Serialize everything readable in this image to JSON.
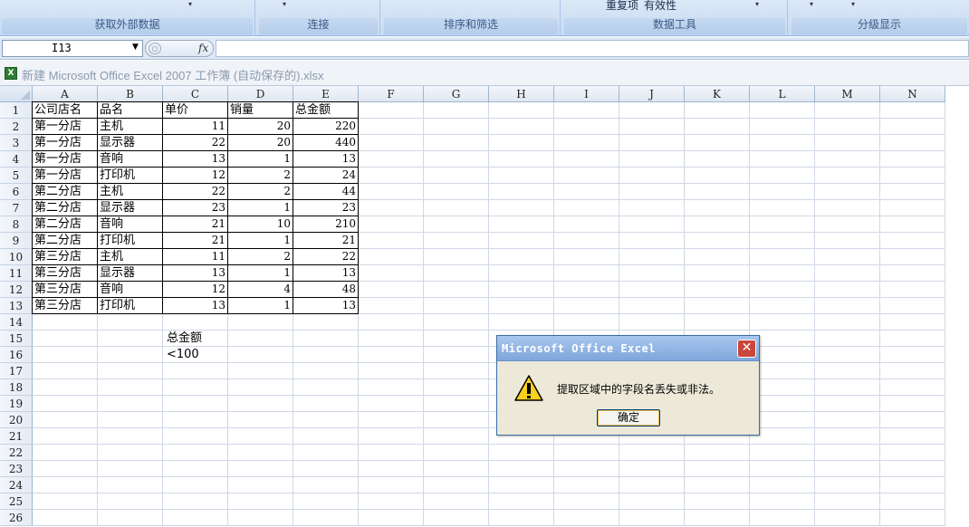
{
  "ribbon": {
    "groups": [
      "获取外部数据",
      "连接",
      "排序和筛选",
      "数据工具",
      "分级显示"
    ],
    "fragments": {
      "dup": "重复项",
      "valid": "有效性"
    }
  },
  "formula_bar": {
    "name_box": "I13",
    "fx": "fx",
    "formula": ""
  },
  "window": {
    "title": "新建 Microsoft Office Excel 2007 工作簿 (自动保存的).xlsx"
  },
  "sheet": {
    "columns": [
      "A",
      "B",
      "C",
      "D",
      "E",
      "F",
      "G",
      "H",
      "I",
      "J",
      "K",
      "L",
      "M",
      "N"
    ],
    "rows": [
      "1",
      "2",
      "3",
      "4",
      "5",
      "6",
      "7",
      "8",
      "9",
      "10",
      "11",
      "12",
      "13",
      "14",
      "15",
      "16",
      "17",
      "18",
      "19",
      "20",
      "21",
      "22",
      "23",
      "24",
      "25",
      "26"
    ],
    "header": [
      "公司店名",
      "品名",
      "单价",
      "销量",
      "总金额"
    ],
    "data": [
      [
        "第一分店",
        "主机",
        "11",
        "20",
        "220"
      ],
      [
        "第一分店",
        "显示器",
        "22",
        "20",
        "440"
      ],
      [
        "第一分店",
        "音响",
        "13",
        "1",
        "13"
      ],
      [
        "第一分店",
        "打印机",
        "12",
        "2",
        "24"
      ],
      [
        "第二分店",
        "主机",
        "22",
        "2",
        "44"
      ],
      [
        "第二分店",
        "显示器",
        "23",
        "1",
        "23"
      ],
      [
        "第二分店",
        "音响",
        "21",
        "10",
        "210"
      ],
      [
        "第二分店",
        "打印机",
        "21",
        "1",
        "21"
      ],
      [
        "第三分店",
        "主机",
        "11",
        "2",
        "22"
      ],
      [
        "第三分店",
        "显示器",
        "13",
        "1",
        "13"
      ],
      [
        "第三分店",
        "音响",
        "12",
        "4",
        "48"
      ],
      [
        "第三分店",
        "打印机",
        "13",
        "1",
        "13"
      ]
    ],
    "criteria": {
      "c15": "总金额",
      "c16": "<100"
    }
  },
  "dialog": {
    "title": "Microsoft Office Excel",
    "message": "提取区域中的字段名丢失或非法。",
    "ok_label": "确定",
    "close_glyph": "✕"
  }
}
